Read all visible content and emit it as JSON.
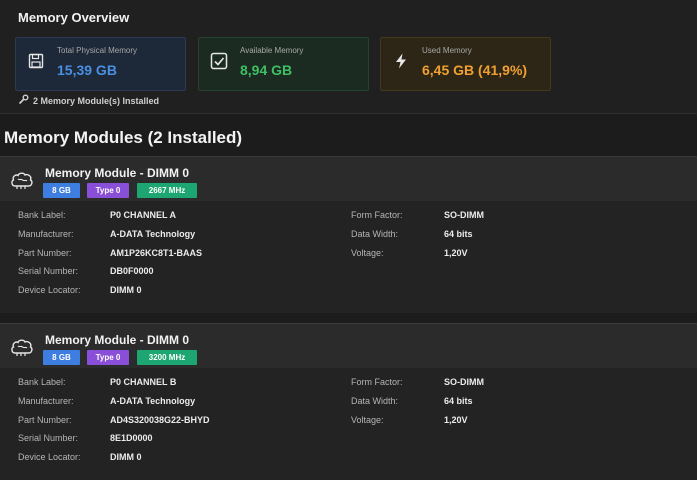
{
  "overview": {
    "title": "Memory Overview",
    "stats": {
      "total": {
        "label": "Total Physical Memory",
        "value": "15,39 GB",
        "icon": "floppy-disk-icon",
        "color": "#4a90e2"
      },
      "available": {
        "label": "Available Memory",
        "value": "8,94 GB",
        "icon": "check-square-icon",
        "color": "#3fbf63"
      },
      "used": {
        "label": "Used Memory",
        "value": "6,45 GB (41,9%)",
        "icon": "lightning-icon",
        "color": "#f0a030"
      }
    },
    "modules_installed": "2 Memory Module(s) Installed"
  },
  "modules_section": {
    "title": "Memory Modules (2 Installed)",
    "modules": [
      {
        "title": "Memory Module - DIMM 0",
        "badges": {
          "size": "8 GB",
          "type": "Type 0",
          "speed": "2667 MHz"
        },
        "specs": {
          "bank_label": {
            "label": "Bank Label:",
            "value": "P0 CHANNEL A"
          },
          "manufacturer": {
            "label": "Manufacturer:",
            "value": "A-DATA Technology"
          },
          "part_number": {
            "label": "Part Number:",
            "value": "AM1P26KC8T1-BAAS"
          },
          "serial_number": {
            "label": "Serial Number:",
            "value": "DB0F0000"
          },
          "device_locator": {
            "label": "Device Locator:",
            "value": "DIMM 0"
          },
          "form_factor": {
            "label": "Form Factor:",
            "value": "SO-DIMM"
          },
          "data_width": {
            "label": "Data Width:",
            "value": "64 bits"
          },
          "voltage": {
            "label": "Voltage:",
            "value": "1,20V"
          }
        }
      },
      {
        "title": "Memory Module - DIMM 0",
        "badges": {
          "size": "8 GB",
          "type": "Type 0",
          "speed": "3200 MHz"
        },
        "specs": {
          "bank_label": {
            "label": "Bank Label:",
            "value": "P0 CHANNEL B"
          },
          "manufacturer": {
            "label": "Manufacturer:",
            "value": "A-DATA Technology"
          },
          "part_number": {
            "label": "Part Number:",
            "value": "AD4S320038G22-BHYD"
          },
          "serial_number": {
            "label": "Serial Number:",
            "value": "8E1D0000"
          },
          "device_locator": {
            "label": "Device Locator:",
            "value": "DIMM 0"
          },
          "form_factor": {
            "label": "Form Factor:",
            "value": "SO-DIMM"
          },
          "data_width": {
            "label": "Data Width:",
            "value": "64 bits"
          },
          "voltage": {
            "label": "Voltage:",
            "value": "1,20V"
          }
        }
      }
    ]
  }
}
